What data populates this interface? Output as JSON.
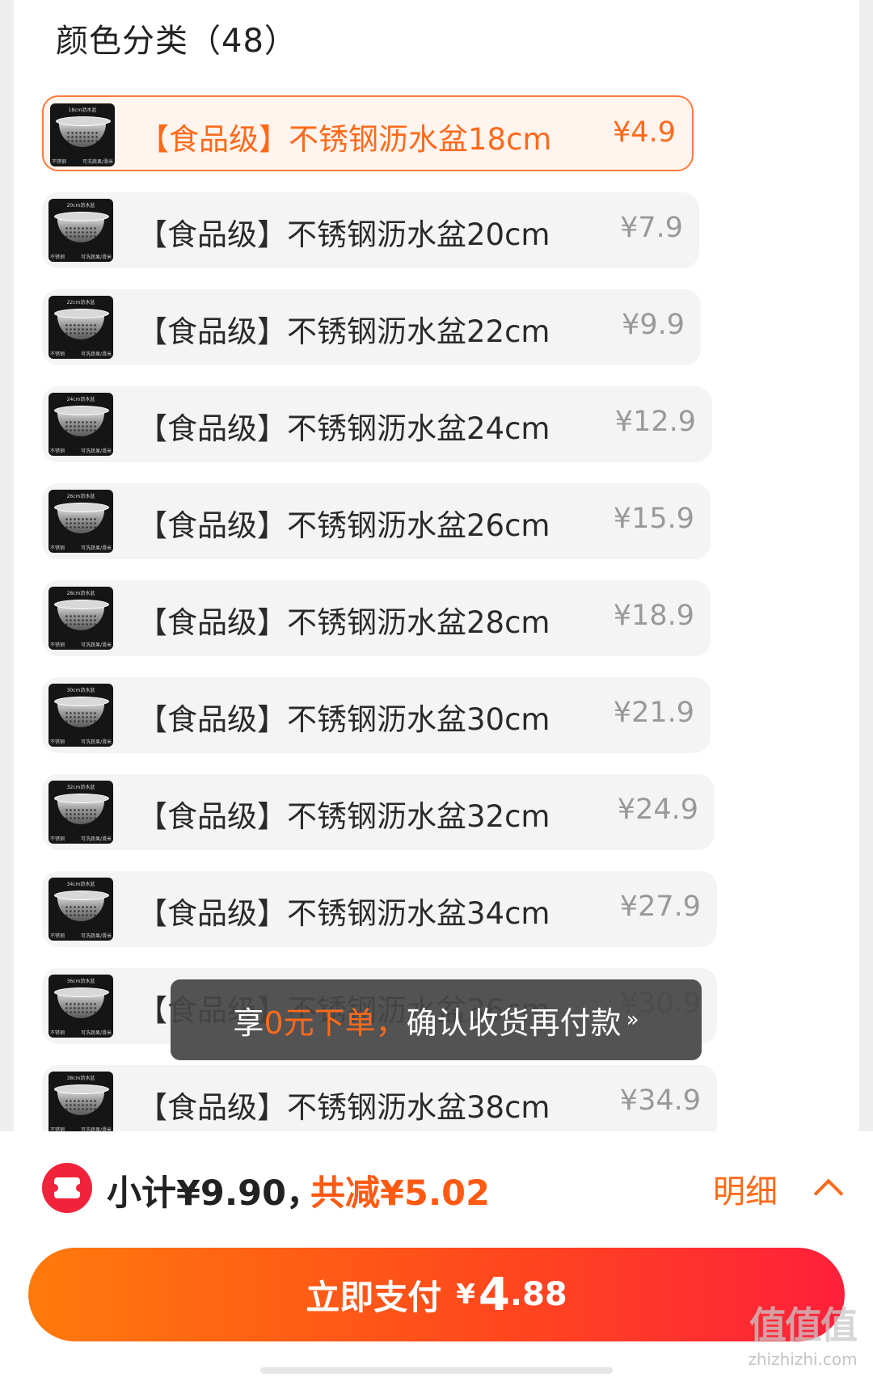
{
  "section": {
    "title": "颜色分类（48）"
  },
  "variants": [
    {
      "name": "【食品级】不锈钢沥水盆18cm",
      "price": "¥4.9",
      "thumb_label": "18cm沥水盆",
      "selected": true
    },
    {
      "name": "【食品级】不锈钢沥水盆20cm",
      "price": "¥7.9",
      "thumb_label": "20cm沥水盆",
      "selected": false
    },
    {
      "name": "【食品级】不锈钢沥水盆22cm",
      "price": "¥9.9",
      "thumb_label": "22cm沥水盆",
      "selected": false
    },
    {
      "name": "【食品级】不锈钢沥水盆24cm",
      "price": "¥12.9",
      "thumb_label": "24cm沥水盆",
      "selected": false
    },
    {
      "name": "【食品级】不锈钢沥水盆26cm",
      "price": "¥15.9",
      "thumb_label": "26cm沥水盆",
      "selected": false
    },
    {
      "name": "【食品级】不锈钢沥水盆28cm",
      "price": "¥18.9",
      "thumb_label": "28cm沥水盆",
      "selected": false
    },
    {
      "name": "【食品级】不锈钢沥水盆30cm",
      "price": "¥21.9",
      "thumb_label": "30cm沥水盆",
      "selected": false
    },
    {
      "name": "【食品级】不锈钢沥水盆32cm",
      "price": "¥24.9",
      "thumb_label": "32cm沥水盆",
      "selected": false
    },
    {
      "name": "【食品级】不锈钢沥水盆34cm",
      "price": "¥27.9",
      "thumb_label": "34cm沥水盆",
      "selected": false
    },
    {
      "name": "【食品级】不锈钢沥水盆36cm",
      "price": "¥30.9",
      "thumb_label": "36cm沥水盆",
      "selected": false
    },
    {
      "name": "【食品级】不锈钢沥水盆38cm",
      "price": "¥34.9",
      "thumb_label": "38cm沥水盆",
      "selected": false
    }
  ],
  "thumb_footer": {
    "left": "不锈钢",
    "right": "可洗蔬果/滑米"
  },
  "toast": {
    "prefix": "享",
    "highlight": "0元下单，",
    "text": "确认收货再付款",
    "chevron": "»"
  },
  "footer": {
    "subtotal": "小计¥9.90，",
    "discount": "共减¥5.02",
    "detail_label": "明细",
    "pay_label": "立即支付",
    "pay_currency": "¥",
    "pay_integer": "4",
    "pay_decimal": ".88"
  },
  "watermark": {
    "logo": "值值值",
    "url": "zhizhizhi.com"
  },
  "colors": {
    "accent": "#ff6a1a",
    "selected_bg": "#fff4ee",
    "coupon_red": "#f0233a",
    "pay_gradient_start": "#ff7a0c",
    "pay_gradient_end": "#ff1f3a"
  },
  "icons": {
    "coupon": "coupon-ticket-icon",
    "detail": "chevron-up-icon",
    "toast": "double-chevron-down-icon"
  }
}
